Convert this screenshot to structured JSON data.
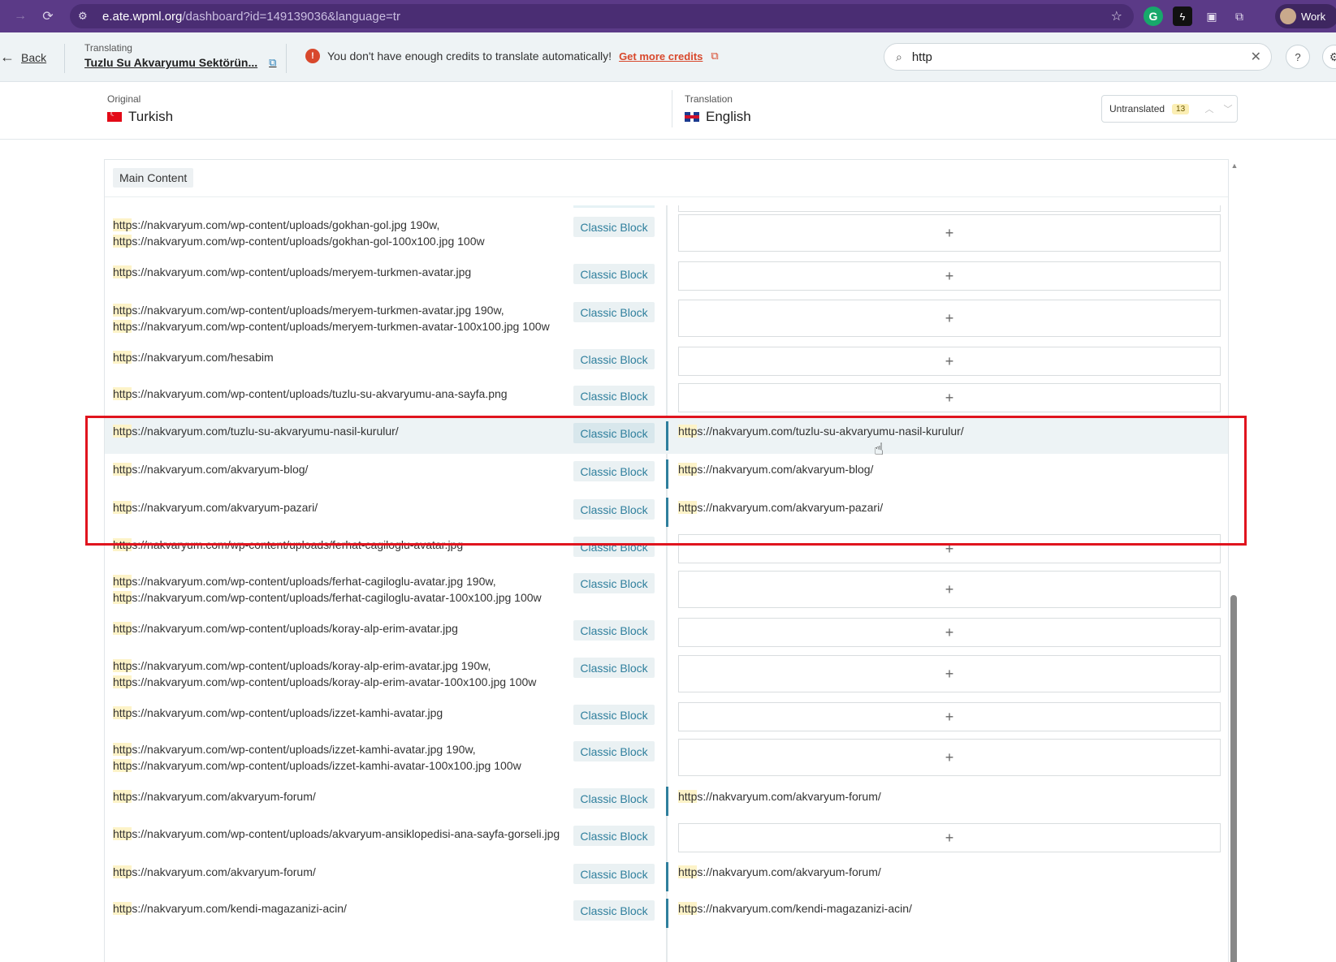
{
  "browser": {
    "url_host": "e.ate.wpml.org",
    "url_path": "/dashboard?id=149139036&language=tr",
    "profile_label": "Work"
  },
  "header": {
    "back_label": "Back",
    "translating_caption": "Translating",
    "document_title": "Tuzlu Su Akvaryumu Sektörün...",
    "warning_text": "You don't have enough credits to translate automatically!",
    "credits_link": "Get more credits",
    "search_value": "http",
    "help_label": "?"
  },
  "languages": {
    "original_caption": "Original",
    "original_name": "Turkish",
    "translation_caption": "Translation",
    "translation_name": "English",
    "filter_label": "Untranslated",
    "filter_count": "13"
  },
  "section": {
    "label": "Main Content"
  },
  "block_label": "Classic Block",
  "rows": [
    {
      "src": [
        "https://nakvaryum.com/wp-content/uploads/gokhan-gol.jpg 190w,",
        "https://nakvaryum.com/wp-content/uploads/gokhan-gol-100x100.jpg 100w"
      ],
      "tgt": ""
    },
    {
      "src": [
        "https://nakvaryum.com/wp-content/uploads/meryem-turkmen-avatar.jpg"
      ],
      "tgt": ""
    },
    {
      "src": [
        "https://nakvaryum.com/wp-content/uploads/meryem-turkmen-avatar.jpg 190w,",
        "https://nakvaryum.com/wp-content/uploads/meryem-turkmen-avatar-100x100.jpg 100w"
      ],
      "tgt": ""
    },
    {
      "src": [
        "https://nakvaryum.com/hesabim"
      ],
      "tgt": ""
    },
    {
      "src": [
        "https://nakvaryum.com/wp-content/uploads/tuzlu-su-akvaryumu-ana-sayfa.png"
      ],
      "tgt": ""
    },
    {
      "src": [
        "https://nakvaryum.com/tuzlu-su-akvaryumu-nasil-kurulur/"
      ],
      "tgt": "https://nakvaryum.com/tuzlu-su-akvaryumu-nasil-kurulur/"
    },
    {
      "src": [
        "https://nakvaryum.com/akvaryum-blog/"
      ],
      "tgt": "https://nakvaryum.com/akvaryum-blog/"
    },
    {
      "src": [
        "https://nakvaryum.com/akvaryum-pazari/"
      ],
      "tgt": "https://nakvaryum.com/akvaryum-pazari/"
    },
    {
      "src": [
        "https://nakvaryum.com/wp-content/uploads/ferhat-cagiloglu-avatar.jpg"
      ],
      "tgt": ""
    },
    {
      "src": [
        "https://nakvaryum.com/wp-content/uploads/ferhat-cagiloglu-avatar.jpg 190w,",
        "https://nakvaryum.com/wp-content/uploads/ferhat-cagiloglu-avatar-100x100.jpg 100w"
      ],
      "tgt": ""
    },
    {
      "src": [
        "https://nakvaryum.com/wp-content/uploads/koray-alp-erim-avatar.jpg"
      ],
      "tgt": ""
    },
    {
      "src": [
        "https://nakvaryum.com/wp-content/uploads/koray-alp-erim-avatar.jpg 190w,",
        "https://nakvaryum.com/wp-content/uploads/koray-alp-erim-avatar-100x100.jpg 100w"
      ],
      "tgt": ""
    },
    {
      "src": [
        "https://nakvaryum.com/wp-content/uploads/izzet-kamhi-avatar.jpg"
      ],
      "tgt": ""
    },
    {
      "src": [
        "https://nakvaryum.com/wp-content/uploads/izzet-kamhi-avatar.jpg 190w,",
        "https://nakvaryum.com/wp-content/uploads/izzet-kamhi-avatar-100x100.jpg 100w"
      ],
      "tgt": ""
    },
    {
      "src": [
        "https://nakvaryum.com/akvaryum-forum/"
      ],
      "tgt": "https://nakvaryum.com/akvaryum-forum/"
    },
    {
      "src": [
        "https://nakvaryum.com/wp-content/uploads/akvaryum-ansiklopedisi-ana-sayfa-gorseli.jpg"
      ],
      "tgt": ""
    },
    {
      "src": [
        "https://nakvaryum.com/akvaryum-forum/"
      ],
      "tgt": "https://nakvaryum.com/akvaryum-forum/"
    },
    {
      "src": [
        "https://nakvaryum.com/kendi-magazanizi-acin/"
      ],
      "tgt": "https://nakvaryum.com/kendi-magazanizi-acin/"
    }
  ],
  "icons": {
    "add": "+",
    "search": "search-icon",
    "clear": "close-icon"
  }
}
